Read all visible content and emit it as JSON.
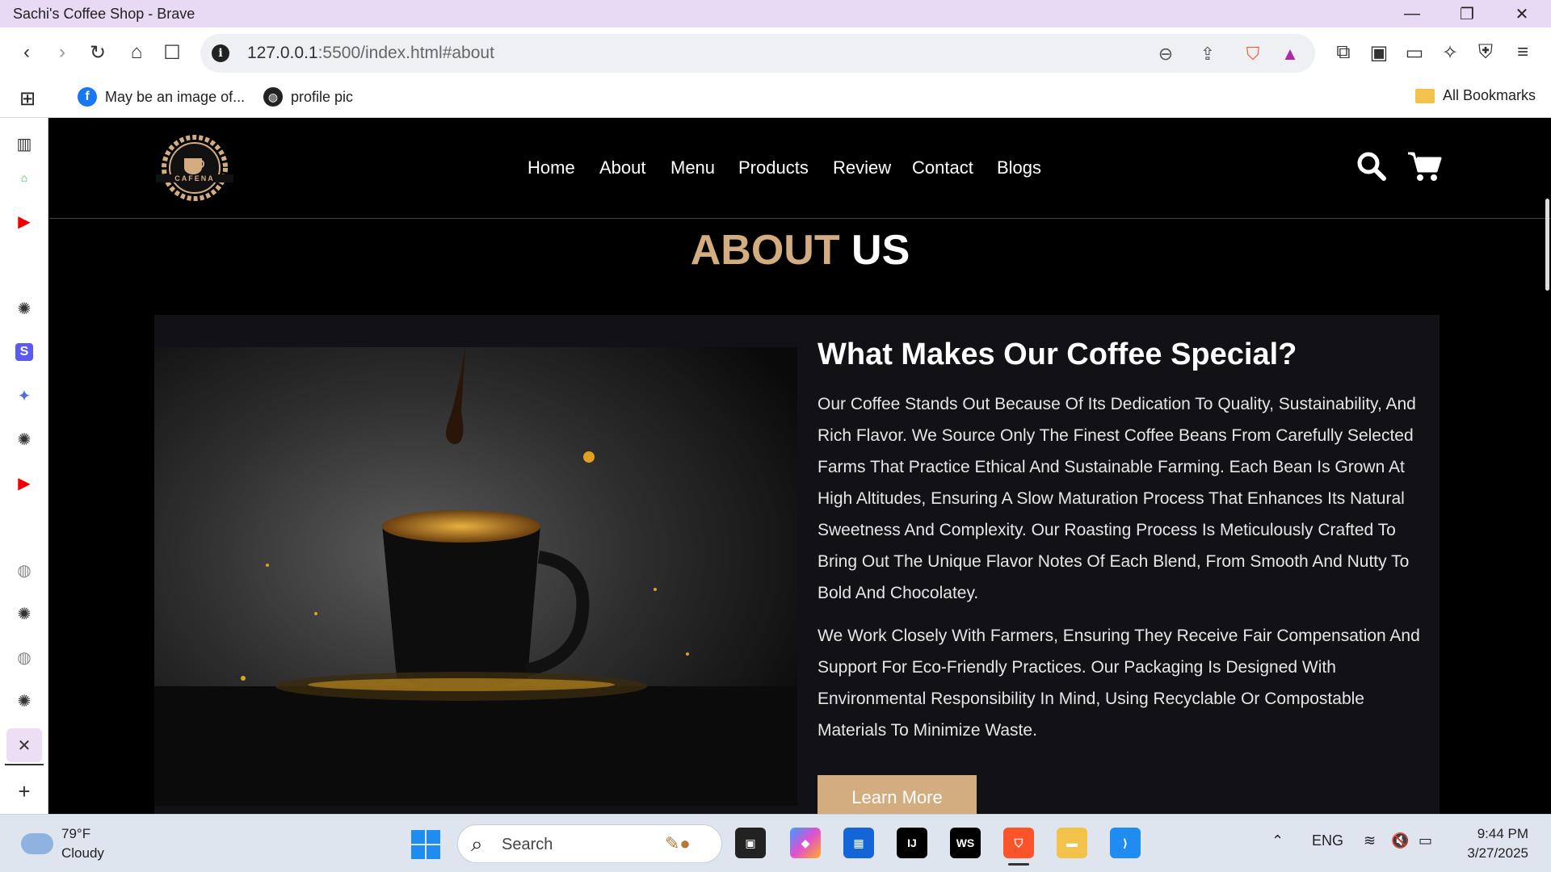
{
  "window": {
    "title": "Sachi's Coffee Shop - Brave"
  },
  "browser": {
    "url_host": "127.0.0.1",
    "url_path": ":5500/index.html#about",
    "shields_count": "1",
    "bookmarks": [
      {
        "label": "May be an image of..."
      },
      {
        "label": "profile pic"
      }
    ],
    "all_bookmarks_label": "All Bookmarks"
  },
  "site": {
    "logo_text": "CAFENA",
    "nav": [
      "Home",
      "About",
      "Menu",
      "Products",
      "Review",
      "Contact",
      "Blogs"
    ],
    "accent_color": "#d3ad7f"
  },
  "about": {
    "heading_accent": "ABOUT",
    "heading_rest": " US",
    "title": "What Makes Our Coffee Special?",
    "paragraphs": [
      "Our Coffee Stands Out Because Of Its Dedication To Quality, Sustainability, And Rich Flavor. We Source Only The Finest Coffee Beans From Carefully Selected Farms That Practice Ethical And Sustainable Farming. Each Bean Is Grown At High Altitudes, Ensuring A Slow Maturation Process That Enhances Its Natural Sweetness And Complexity. Our Roasting Process Is Meticulously Crafted To Bring Out The Unique Flavor Notes Of Each Blend, From Smooth And Nutty To Bold And Chocolatey.",
      "We Work Closely With Farmers, Ensuring They Receive Fair Compensation And Support For Eco-Friendly Practices. Our Packaging Is Designed With Environmental Responsibility In Mind, Using Recyclable Or Compostable Materials To Minimize Waste."
    ],
    "button_label": "Learn More"
  },
  "taskbar": {
    "temperature": "79°F",
    "weather": "Cloudy",
    "search_placeholder": "Search",
    "language": "ENG",
    "time": "9:44 PM",
    "date": "3/27/2025"
  }
}
